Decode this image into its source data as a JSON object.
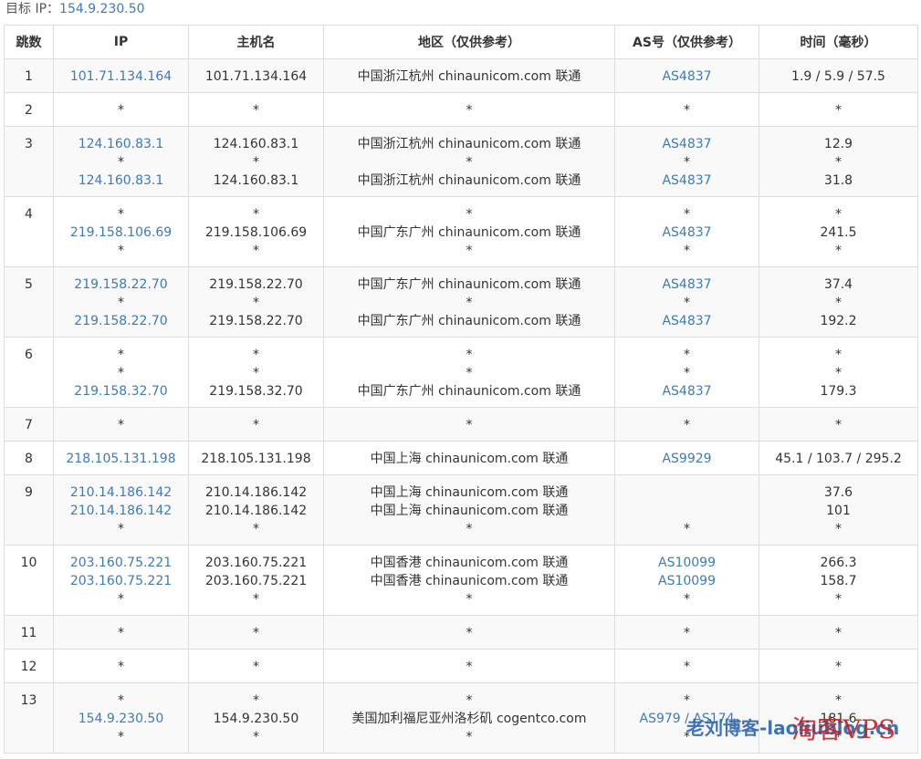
{
  "target": {
    "label": "目标 IP：",
    "ip": "154.9.230.50"
  },
  "columns": [
    "跳数",
    "IP",
    "主机名",
    "地区（仅供参考）",
    "AS号（仅供参考）",
    "时间（毫秒）"
  ],
  "rows": [
    {
      "hop": "1",
      "lines": [
        {
          "ip": "101.71.134.164",
          "host": "101.71.134.164",
          "region": "中国浙江杭州 chinaunicom.com 联通",
          "as": "AS4837",
          "time": "1.9 / 5.9 / 57.5"
        }
      ]
    },
    {
      "hop": "2",
      "lines": [
        {
          "ip": "*",
          "host": "*",
          "region": "*",
          "as": "*",
          "time": "*"
        }
      ]
    },
    {
      "hop": "3",
      "lines": [
        {
          "ip": "124.160.83.1",
          "host": "124.160.83.1",
          "region": "中国浙江杭州 chinaunicom.com 联通",
          "as": "AS4837",
          "time": "12.9"
        },
        {
          "ip": "*",
          "host": "*",
          "region": "*",
          "as": "*",
          "time": "*"
        },
        {
          "ip": "124.160.83.1",
          "host": "124.160.83.1",
          "region": "中国浙江杭州 chinaunicom.com 联通",
          "as": "AS4837",
          "time": "31.8"
        }
      ]
    },
    {
      "hop": "4",
      "lines": [
        {
          "ip": "*",
          "host": "*",
          "region": "*",
          "as": "*",
          "time": "*"
        },
        {
          "ip": "219.158.106.69",
          "host": "219.158.106.69",
          "region": "中国广东广州 chinaunicom.com 联通",
          "as": "AS4837",
          "time": "241.5"
        },
        {
          "ip": "*",
          "host": "*",
          "region": "*",
          "as": "*",
          "time": "*"
        }
      ]
    },
    {
      "hop": "5",
      "lines": [
        {
          "ip": "219.158.22.70",
          "host": "219.158.22.70",
          "region": "中国广东广州 chinaunicom.com 联通",
          "as": "AS4837",
          "time": "37.4"
        },
        {
          "ip": "*",
          "host": "*",
          "region": "*",
          "as": "*",
          "time": "*"
        },
        {
          "ip": "219.158.22.70",
          "host": "219.158.22.70",
          "region": "中国广东广州 chinaunicom.com 联通",
          "as": "AS4837",
          "time": "192.2"
        }
      ]
    },
    {
      "hop": "6",
      "lines": [
        {
          "ip": "*",
          "host": "*",
          "region": "*",
          "as": "*",
          "time": "*"
        },
        {
          "ip": "*",
          "host": "*",
          "region": "*",
          "as": "*",
          "time": "*"
        },
        {
          "ip": "219.158.32.70",
          "host": "219.158.32.70",
          "region": "中国广东广州 chinaunicom.com 联通",
          "as": "AS4837",
          "time": "179.3"
        }
      ]
    },
    {
      "hop": "7",
      "lines": [
        {
          "ip": "*",
          "host": "*",
          "region": "*",
          "as": "*",
          "time": "*"
        }
      ]
    },
    {
      "hop": "8",
      "lines": [
        {
          "ip": "218.105.131.198",
          "host": "218.105.131.198",
          "region": "中国上海 chinaunicom.com 联通",
          "as": "AS9929",
          "time": "45.1 / 103.7 / 295.2"
        }
      ]
    },
    {
      "hop": "9",
      "lines": [
        {
          "ip": "210.14.186.142",
          "host": "210.14.186.142",
          "region": "中国上海 chinaunicom.com 联通",
          "as": "",
          "time": "37.6"
        },
        {
          "ip": "210.14.186.142",
          "host": "210.14.186.142",
          "region": "中国上海 chinaunicom.com 联通",
          "as": "",
          "time": "101"
        },
        {
          "ip": "*",
          "host": "*",
          "region": "*",
          "as": "*",
          "time": "*"
        }
      ]
    },
    {
      "hop": "10",
      "lines": [
        {
          "ip": "203.160.75.221",
          "host": "203.160.75.221",
          "region": "中国香港 chinaunicom.com 联通",
          "as": "AS10099",
          "time": "266.3"
        },
        {
          "ip": "203.160.75.221",
          "host": "203.160.75.221",
          "region": "中国香港 chinaunicom.com 联通",
          "as": "AS10099",
          "time": "158.7"
        },
        {
          "ip": "*",
          "host": "*",
          "region": "*",
          "as": "*",
          "time": "*"
        }
      ]
    },
    {
      "hop": "11",
      "lines": [
        {
          "ip": "*",
          "host": "*",
          "region": "*",
          "as": "*",
          "time": "*"
        }
      ]
    },
    {
      "hop": "12",
      "lines": [
        {
          "ip": "*",
          "host": "*",
          "region": "*",
          "as": "*",
          "time": "*"
        }
      ]
    },
    {
      "hop": "13",
      "lines": [
        {
          "ip": "*",
          "host": "*",
          "region": "*",
          "as": "*",
          "time": "*"
        },
        {
          "ip": "154.9.230.50",
          "host": "154.9.230.50",
          "region": "美国加利福尼亚州洛杉矶 cogentco.com",
          "as": "AS979 / AS174",
          "time": "181.6"
        },
        {
          "ip": "*",
          "host": "*",
          "region": "*",
          "as": "*",
          "time": "*"
        }
      ]
    }
  ],
  "watermark": {
    "blog": "老刘博客-laoliublog.cn",
    "brand": "淘客VPS"
  },
  "colors": {
    "link": "#3d7ab8",
    "border": "#dddddd",
    "stripe": "#f9f9f9",
    "text": "#333333"
  }
}
